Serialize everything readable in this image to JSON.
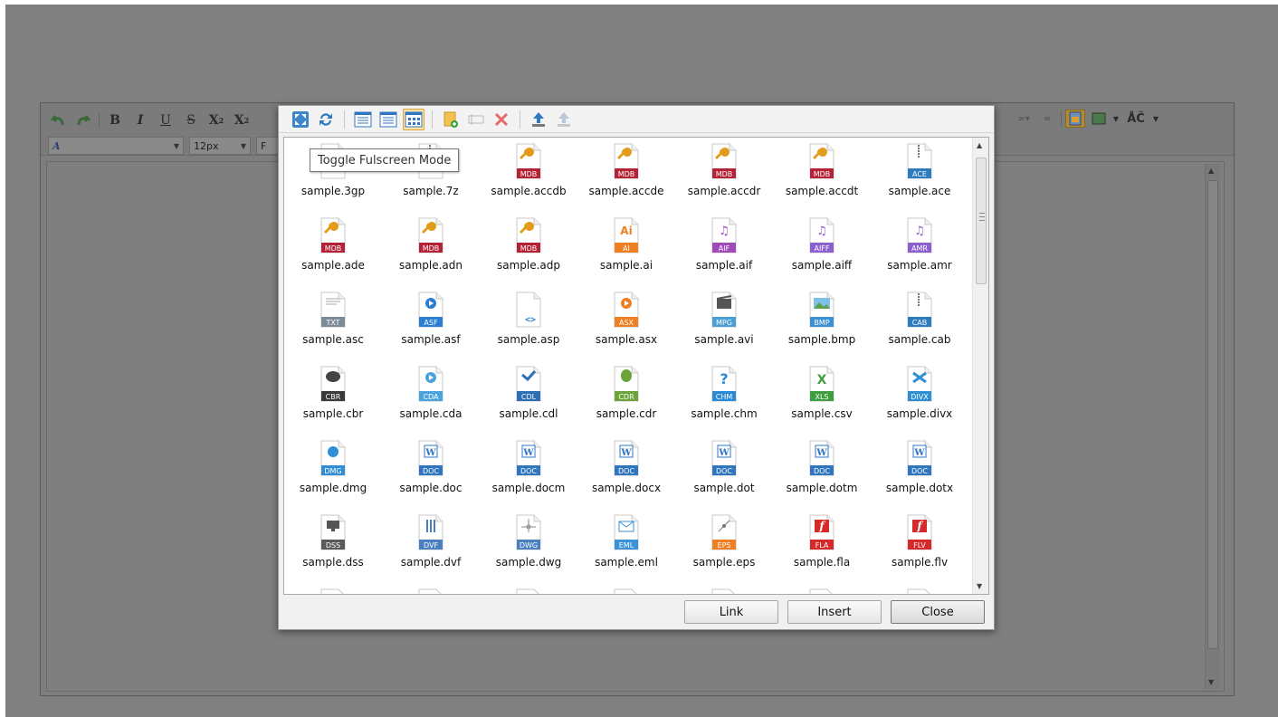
{
  "editor": {
    "font_size_value": "12px",
    "style_value": "A",
    "font_value": "F"
  },
  "dialog": {
    "tooltip": "Toggle Fulscreen Mode",
    "files": [
      {
        "name": "sample.3gp",
        "badge": "",
        "color": "#1aa0b5",
        "kind": "doc"
      },
      {
        "name": "sample.7z",
        "badge": "",
        "color": "#7a4fa5",
        "kind": "zip"
      },
      {
        "name": "sample.accdb",
        "badge": "MDB",
        "color": "#b52236",
        "kind": "key"
      },
      {
        "name": "sample.accde",
        "badge": "MDB",
        "color": "#b52236",
        "kind": "key"
      },
      {
        "name": "sample.accdr",
        "badge": "MDB",
        "color": "#b52236",
        "kind": "key"
      },
      {
        "name": "sample.accdt",
        "badge": "MDB",
        "color": "#b52236",
        "kind": "key"
      },
      {
        "name": "sample.ace",
        "badge": "ACE",
        "color": "#2f7bc0",
        "kind": "zip"
      },
      {
        "name": "sample.ade",
        "badge": "MDB",
        "color": "#b52236",
        "kind": "key"
      },
      {
        "name": "sample.adn",
        "badge": "MDB",
        "color": "#b52236",
        "kind": "key"
      },
      {
        "name": "sample.adp",
        "badge": "MDB",
        "color": "#b52236",
        "kind": "key"
      },
      {
        "name": "sample.ai",
        "badge": "AI",
        "color": "#ee7f22",
        "kind": "ai"
      },
      {
        "name": "sample.aif",
        "badge": "AIF",
        "color": "#a04ab8",
        "kind": "music"
      },
      {
        "name": "sample.aiff",
        "badge": "AIFF",
        "color": "#8b5fcf",
        "kind": "music"
      },
      {
        "name": "sample.amr",
        "badge": "AMR",
        "color": "#8b5fcf",
        "kind": "music"
      },
      {
        "name": "sample.asc",
        "badge": "TXT",
        "color": "#7d8a97",
        "kind": "text"
      },
      {
        "name": "sample.asf",
        "badge": "ASF",
        "color": "#2b7fd2",
        "kind": "play"
      },
      {
        "name": "sample.asp",
        "badge": "",
        "color": "#2b7fd2",
        "kind": "code"
      },
      {
        "name": "sample.asx",
        "badge": "ASX",
        "color": "#ee7f22",
        "kind": "play"
      },
      {
        "name": "sample.avi",
        "badge": "MPG",
        "color": "#4a9fd5",
        "kind": "clap"
      },
      {
        "name": "sample.bmp",
        "badge": "BMP",
        "color": "#3b8fd3",
        "kind": "image"
      },
      {
        "name": "sample.cab",
        "badge": "CAB",
        "color": "#2f7bc0",
        "kind": "zip"
      },
      {
        "name": "sample.cbr",
        "badge": "CBR",
        "color": "#3a3a3a",
        "kind": "bubble"
      },
      {
        "name": "sample.cda",
        "badge": "CDA",
        "color": "#4aa3dc",
        "kind": "play"
      },
      {
        "name": "sample.cdl",
        "badge": "CDL",
        "color": "#2f6fb5",
        "kind": "check"
      },
      {
        "name": "sample.cdr",
        "badge": "CDR",
        "color": "#6aa43a",
        "kind": "balloon"
      },
      {
        "name": "sample.chm",
        "badge": "CHM",
        "color": "#2b8ad6",
        "kind": "help"
      },
      {
        "name": "sample.csv",
        "badge": "XLS",
        "color": "#3f9f3f",
        "kind": "excel"
      },
      {
        "name": "sample.divx",
        "badge": "DIVX",
        "color": "#2e8fd3",
        "kind": "x"
      },
      {
        "name": "sample.dmg",
        "badge": "DMG",
        "color": "#2f8ed6",
        "kind": "apple"
      },
      {
        "name": "sample.doc",
        "badge": "DOC",
        "color": "#2f75c0",
        "kind": "word"
      },
      {
        "name": "sample.docm",
        "badge": "DOC",
        "color": "#2f75c0",
        "kind": "word"
      },
      {
        "name": "sample.docx",
        "badge": "DOC",
        "color": "#2f75c0",
        "kind": "word"
      },
      {
        "name": "sample.dot",
        "badge": "DOC",
        "color": "#2f75c0",
        "kind": "word"
      },
      {
        "name": "sample.dotm",
        "badge": "DOC",
        "color": "#2f75c0",
        "kind": "word"
      },
      {
        "name": "sample.dotx",
        "badge": "DOC",
        "color": "#2f75c0",
        "kind": "word"
      },
      {
        "name": "sample.dss",
        "badge": "DSS",
        "color": "#5a5a5a",
        "kind": "monitor"
      },
      {
        "name": "sample.dvf",
        "badge": "DVF",
        "color": "#4a7fc0",
        "kind": "bars"
      },
      {
        "name": "sample.dwg",
        "badge": "DWG",
        "color": "#4a7fc0",
        "kind": "cad"
      },
      {
        "name": "sample.eml",
        "badge": "EML",
        "color": "#3b92d6",
        "kind": "mail"
      },
      {
        "name": "sample.eps",
        "badge": "EPS",
        "color": "#ee7f22",
        "kind": "pen"
      },
      {
        "name": "sample.fla",
        "badge": "FLA",
        "color": "#d62a2a",
        "kind": "flash"
      },
      {
        "name": "sample.flv",
        "badge": "FLV",
        "color": "#d62a2a",
        "kind": "flash"
      }
    ],
    "buttons": {
      "link": "Link",
      "insert": "Insert",
      "close": "Close"
    }
  }
}
